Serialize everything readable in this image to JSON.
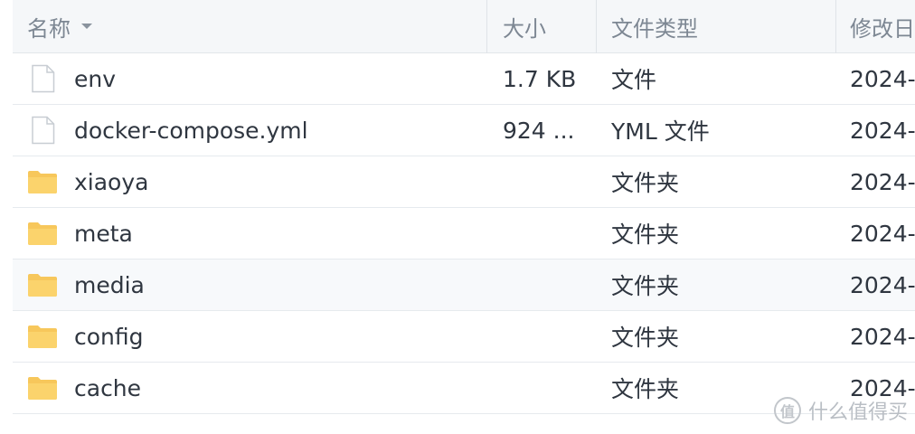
{
  "header": {
    "name": "名称",
    "size": "大小",
    "type": "文件类型",
    "date": "修改日"
  },
  "files": [
    {
      "name": "env",
      "size": "1.7 KB",
      "type": "文件",
      "date": "2024-",
      "icon": "file-icon"
    },
    {
      "name": "docker-compose.yml",
      "size": "924 ...",
      "type": "YML 文件",
      "date": "2024-",
      "icon": "file-icon"
    },
    {
      "name": "xiaoya",
      "size": "",
      "type": "文件夹",
      "date": "2024-",
      "icon": "folder-icon"
    },
    {
      "name": "meta",
      "size": "",
      "type": "文件夹",
      "date": "2024-",
      "icon": "folder-icon"
    },
    {
      "name": "media",
      "size": "",
      "type": "文件夹",
      "date": "2024-",
      "icon": "folder-icon"
    },
    {
      "name": "config",
      "size": "",
      "type": "文件夹",
      "date": "2024-",
      "icon": "folder-icon"
    },
    {
      "name": "cache",
      "size": "",
      "type": "文件夹",
      "date": "2024-",
      "icon": "folder-icon"
    }
  ],
  "watermark": {
    "logo": "值",
    "text": "什么值得买"
  },
  "colors": {
    "folder": "#f7c75b",
    "file_outline": "#c8cdd3",
    "header_bg": "#f5f7f9"
  }
}
